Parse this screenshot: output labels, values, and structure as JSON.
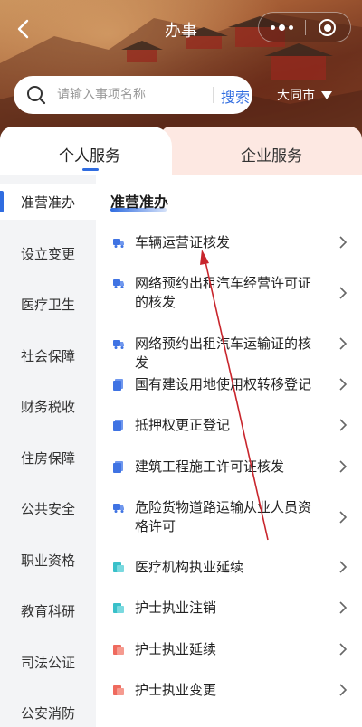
{
  "nav": {
    "title": "办事"
  },
  "search": {
    "placeholder": "请输入事项名称",
    "button": "搜索"
  },
  "city": {
    "name": "大同市"
  },
  "tabs": [
    {
      "label": "个人服务",
      "active": true
    },
    {
      "label": "企业服务",
      "active": false
    }
  ],
  "sidebar": {
    "items": [
      {
        "label": "准营准办",
        "active": true
      },
      {
        "label": "设立变更"
      },
      {
        "label": "医疗卫生"
      },
      {
        "label": "社会保障"
      },
      {
        "label": "财务税收"
      },
      {
        "label": "住房保障"
      },
      {
        "label": "公共安全"
      },
      {
        "label": "职业资格"
      },
      {
        "label": "教育科研"
      },
      {
        "label": "司法公证"
      },
      {
        "label": "公安消防"
      }
    ]
  },
  "section": {
    "title": "准营准办"
  },
  "services": [
    {
      "label": "车辆运营证核发",
      "icon": "vehicle-icon"
    },
    {
      "label": "网络预约出租汽车经营许可证的核发",
      "icon": "vehicle-icon"
    },
    {
      "label": "网络预约出租汽车运输证的核发",
      "icon": "vehicle-icon"
    },
    {
      "label": "国有建设用地使用权转移登记",
      "icon": "document-icon"
    },
    {
      "label": "抵押权更正登记",
      "icon": "document-icon"
    },
    {
      "label": "建筑工程施工许可证核发",
      "icon": "document-icon"
    },
    {
      "label": "危险货物道路运输从业人员资格许可",
      "icon": "vehicle-icon"
    },
    {
      "label": "医疗机构执业延续",
      "icon": "medical-icon"
    },
    {
      "label": "护士执业注销",
      "icon": "medical-icon"
    },
    {
      "label": "护士执业延续",
      "icon": "license-icon"
    },
    {
      "label": "护士执业变更",
      "icon": "license-icon"
    }
  ],
  "colors": {
    "accent": "#2f6ce0",
    "vehicle_icon": "#3f73e3",
    "document_icon": "#3f73e3",
    "medical_icon": "#39c0c9",
    "license_icon": "#ef6a5e",
    "annotation": "#c8252c"
  }
}
